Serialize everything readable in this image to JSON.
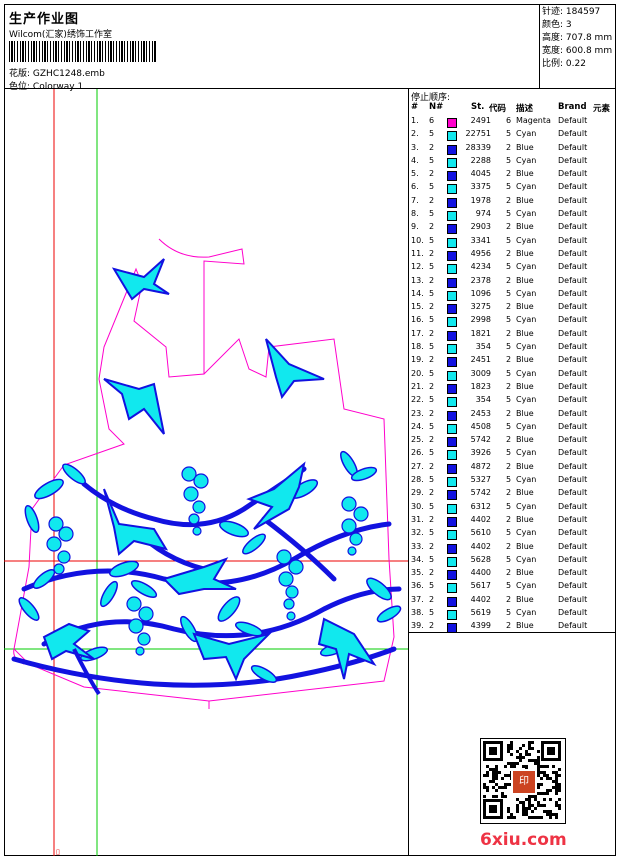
{
  "header": {
    "title": "生产作业图",
    "studio": "Wilcom(汇家)绣饰工作室",
    "file_label": "花版:",
    "file_name": "GZHC1248.emb",
    "colorway_label": "色位:",
    "colorway_name": "Colorway 1"
  },
  "stats": [
    {
      "label": "针迹:",
      "value": "184597"
    },
    {
      "label": "颜色:",
      "value": "3"
    },
    {
      "label": "高度:",
      "value": "707.8 mm"
    },
    {
      "label": "宽度:",
      "value": "600.8 mm"
    },
    {
      "label": "比例:",
      "value": "0.22"
    }
  ],
  "stop_sequence": {
    "title": "停止顺序:",
    "columns": [
      "#",
      "N#",
      "St.",
      "代码",
      "描述",
      "Brand",
      "元素"
    ],
    "colors": {
      "Magenta": "#ff00cc",
      "Cyan": "#11e8ee",
      "Blue": "#1212e0"
    },
    "rows": [
      [
        "1.",
        "6",
        "2491",
        "6",
        "Magenta",
        "Default"
      ],
      [
        "2.",
        "5",
        "22751",
        "5",
        "Cyan",
        "Default"
      ],
      [
        "3.",
        "2",
        "28339",
        "2",
        "Blue",
        "Default"
      ],
      [
        "4.",
        "5",
        "2288",
        "5",
        "Cyan",
        "Default"
      ],
      [
        "5.",
        "2",
        "4045",
        "2",
        "Blue",
        "Default"
      ],
      [
        "6.",
        "5",
        "3375",
        "5",
        "Cyan",
        "Default"
      ],
      [
        "7.",
        "2",
        "1978",
        "2",
        "Blue",
        "Default"
      ],
      [
        "8.",
        "5",
        "974",
        "5",
        "Cyan",
        "Default"
      ],
      [
        "9.",
        "2",
        "2903",
        "2",
        "Blue",
        "Default"
      ],
      [
        "10.",
        "5",
        "3341",
        "5",
        "Cyan",
        "Default"
      ],
      [
        "11.",
        "2",
        "4956",
        "2",
        "Blue",
        "Default"
      ],
      [
        "12.",
        "5",
        "4234",
        "5",
        "Cyan",
        "Default"
      ],
      [
        "13.",
        "2",
        "2378",
        "2",
        "Blue",
        "Default"
      ],
      [
        "14.",
        "5",
        "1096",
        "5",
        "Cyan",
        "Default"
      ],
      [
        "15.",
        "2",
        "3275",
        "2",
        "Blue",
        "Default"
      ],
      [
        "16.",
        "5",
        "2998",
        "5",
        "Cyan",
        "Default"
      ],
      [
        "17.",
        "2",
        "1821",
        "2",
        "Blue",
        "Default"
      ],
      [
        "18.",
        "5",
        "354",
        "5",
        "Cyan",
        "Default"
      ],
      [
        "19.",
        "2",
        "2451",
        "2",
        "Blue",
        "Default"
      ],
      [
        "20.",
        "5",
        "3009",
        "5",
        "Cyan",
        "Default"
      ],
      [
        "21.",
        "2",
        "1823",
        "2",
        "Blue",
        "Default"
      ],
      [
        "22.",
        "5",
        "354",
        "5",
        "Cyan",
        "Default"
      ],
      [
        "23.",
        "2",
        "2453",
        "2",
        "Blue",
        "Default"
      ],
      [
        "24.",
        "5",
        "4508",
        "5",
        "Cyan",
        "Default"
      ],
      [
        "25.",
        "2",
        "5742",
        "2",
        "Blue",
        "Default"
      ],
      [
        "26.",
        "5",
        "3926",
        "5",
        "Cyan",
        "Default"
      ],
      [
        "27.",
        "2",
        "4872",
        "2",
        "Blue",
        "Default"
      ],
      [
        "28.",
        "5",
        "5327",
        "5",
        "Cyan",
        "Default"
      ],
      [
        "29.",
        "2",
        "5742",
        "2",
        "Blue",
        "Default"
      ],
      [
        "30.",
        "5",
        "6312",
        "5",
        "Cyan",
        "Default"
      ],
      [
        "31.",
        "2",
        "4402",
        "2",
        "Blue",
        "Default"
      ],
      [
        "32.",
        "5",
        "5610",
        "5",
        "Cyan",
        "Default"
      ],
      [
        "33.",
        "2",
        "4402",
        "2",
        "Blue",
        "Default"
      ],
      [
        "34.",
        "5",
        "5628",
        "5",
        "Cyan",
        "Default"
      ],
      [
        "35.",
        "2",
        "4400",
        "2",
        "Blue",
        "Default"
      ],
      [
        "36.",
        "5",
        "5617",
        "5",
        "Cyan",
        "Default"
      ],
      [
        "37.",
        "2",
        "4402",
        "2",
        "Blue",
        "Default"
      ],
      [
        "38.",
        "5",
        "5619",
        "5",
        "Cyan",
        "Default"
      ],
      [
        "39.",
        "2",
        "4399",
        "2",
        "Blue",
        "Default"
      ]
    ]
  },
  "seal_text": "印",
  "watermark": "6xiu.com"
}
